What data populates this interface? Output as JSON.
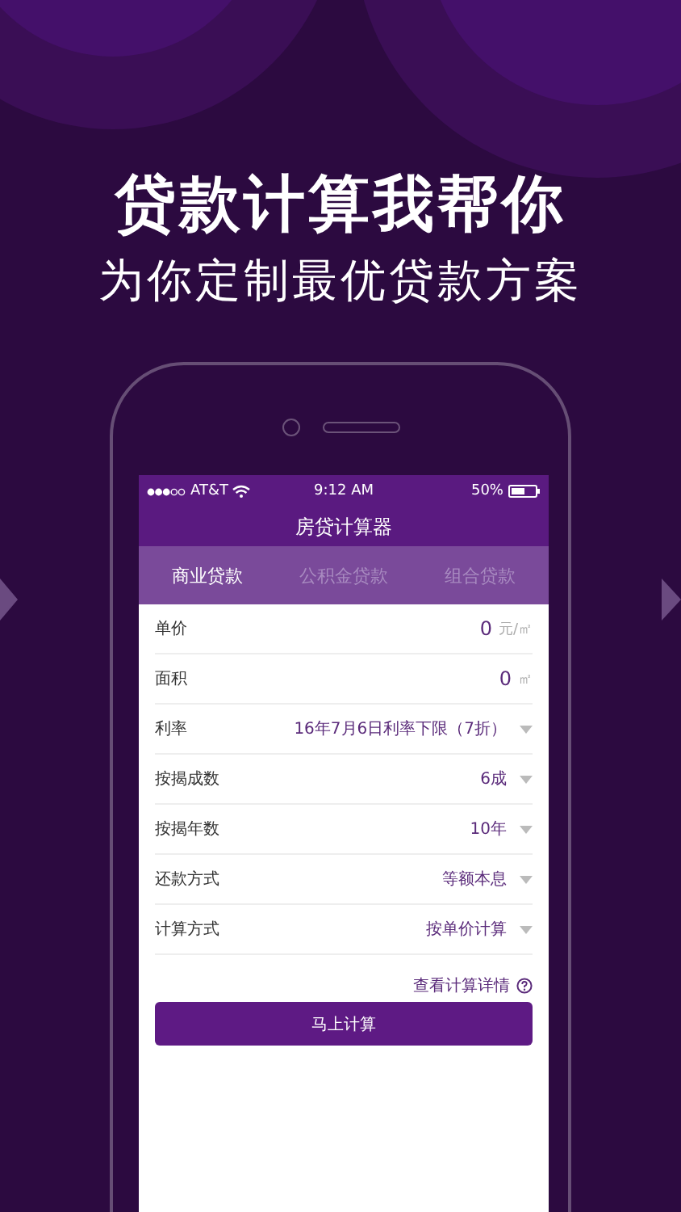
{
  "headline": "贷款计算我帮你",
  "subheadline": "为你定制最优贷款方案",
  "status_bar": {
    "carrier": "AT&T",
    "time": "9:12 AM",
    "battery": "50%"
  },
  "app": {
    "title": "房贷计算器",
    "tabs": [
      {
        "label": "商业贷款",
        "selected": true
      },
      {
        "label": "公积金贷款",
        "selected": false
      },
      {
        "label": "组合贷款",
        "selected": false
      }
    ],
    "fields": [
      {
        "kind": "input",
        "label": "单价",
        "value": "0",
        "unit": "元/㎡"
      },
      {
        "kind": "input",
        "label": "面积",
        "value": "0",
        "unit": "㎡"
      },
      {
        "kind": "select",
        "label": "利率",
        "value": "16年7月6日利率下限（7折）"
      },
      {
        "kind": "select",
        "label": "按揭成数",
        "value": "6成"
      },
      {
        "kind": "select",
        "label": "按揭年数",
        "value": "10年"
      },
      {
        "kind": "select",
        "label": "还款方式",
        "value": "等额本息"
      },
      {
        "kind": "select",
        "label": "计算方式",
        "value": "按单价计算"
      }
    ],
    "details_link": "查看计算详情",
    "submit_button": "马上计算"
  }
}
